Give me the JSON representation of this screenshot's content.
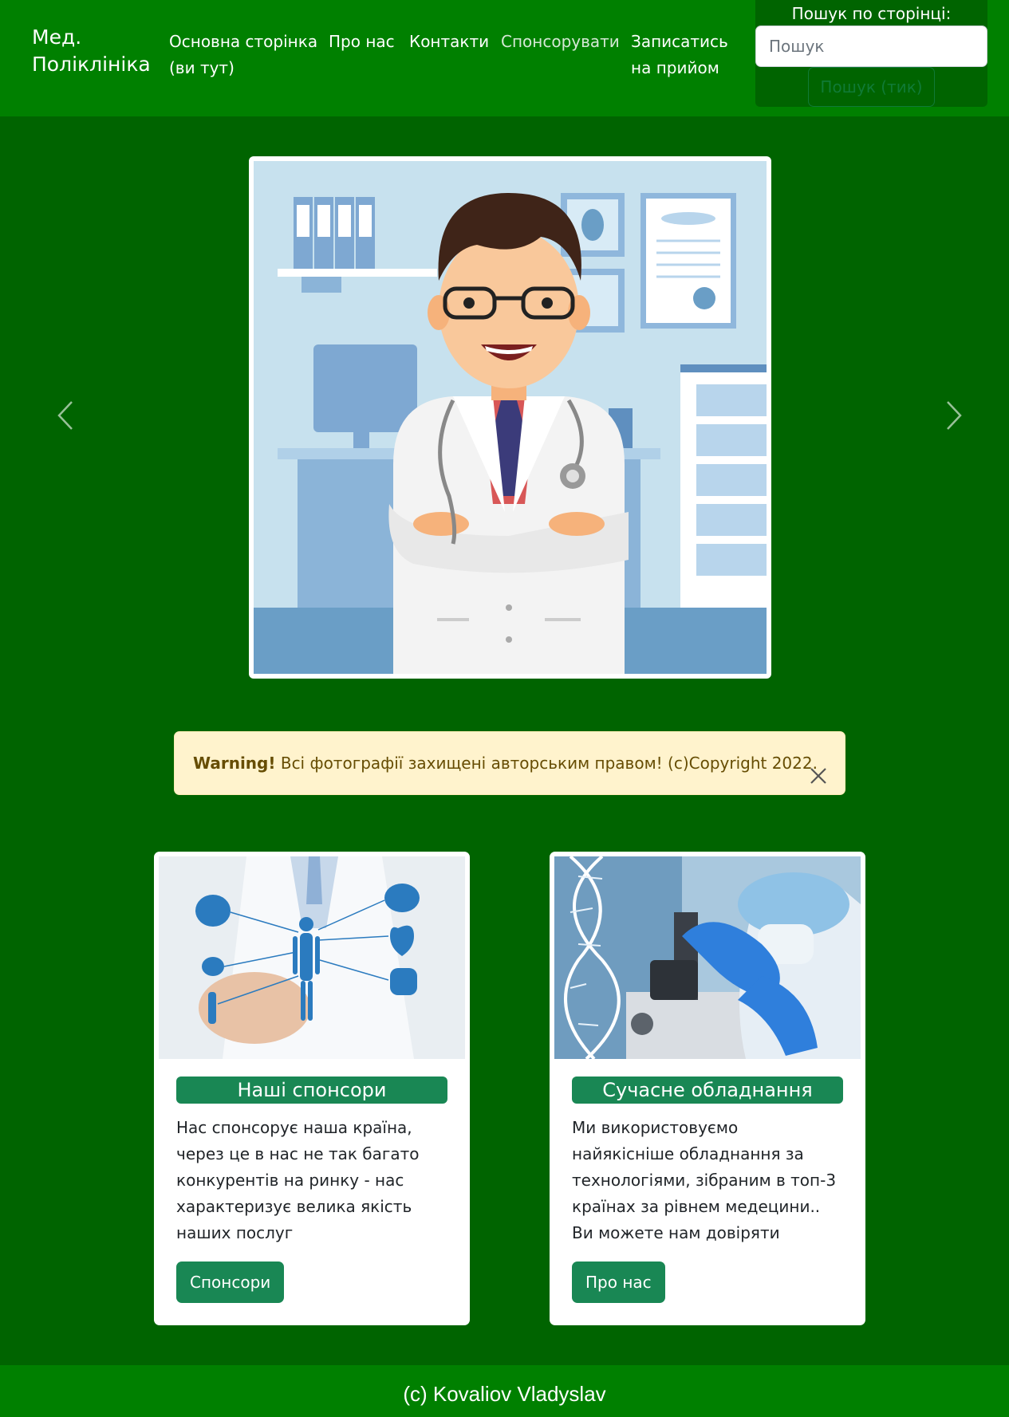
{
  "navbar": {
    "brand": "Мед. Поліклініка",
    "links": [
      {
        "label": "Основна сторінка (ви тут)"
      },
      {
        "label": "Про нас"
      },
      {
        "label": "Контакти"
      },
      {
        "label": "Спонсорувати"
      },
      {
        "label": "Записатись на прийом"
      }
    ],
    "search": {
      "title": "Пошук по сторінці:",
      "placeholder": "Пошук",
      "button_label": "Пошук (тик)"
    }
  },
  "carousel": {
    "image_icon": "doctor-illustration",
    "prev_icon": "chevron-left-icon",
    "next_icon": "chevron-right-icon"
  },
  "alert": {
    "strong": "Warning!",
    "text": " Всі фотографії захищені авторським правом! (c)Copyright 2022.",
    "close_icon": "close-icon",
    "colors": {
      "background": "#fff3cd",
      "text": "#664d03"
    }
  },
  "cards": [
    {
      "title": "Наші спонсори",
      "text": "Нас спонсорує наша країна, через це в нас не так багато конкурентів на ринку - нас характеризує велика якість наших послуг",
      "button": "Спонсори"
    },
    {
      "title": "Сучасне обладнання",
      "text": "Ми використовуємо найякісніше обладнання за технологіями, зібраним в топ-3 країнах за рівнем медецини.. Ви можете нам довіряти",
      "button": "Про нас"
    }
  ],
  "footer": {
    "text": "(c) Kovaliov Vladyslav"
  },
  "colors": {
    "page_background": "#006400",
    "navbar_background": "#008000",
    "accent": "#198754"
  }
}
